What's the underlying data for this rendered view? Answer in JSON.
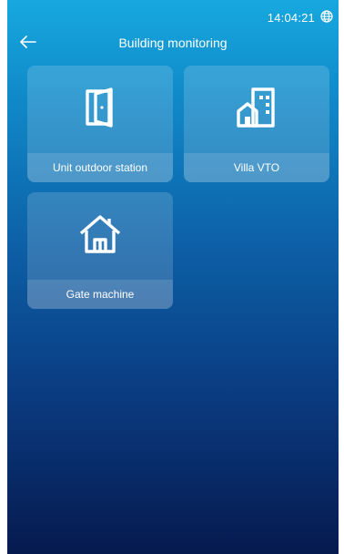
{
  "status_bar": {
    "time": "14:04:21",
    "globe_icon": "globe-icon"
  },
  "header": {
    "back_icon": "arrow-left-icon",
    "title": "Building monitoring"
  },
  "tiles": [
    {
      "label": "Unit outdoor station",
      "icon": "door-icon"
    },
    {
      "label": "Villa VTO",
      "icon": "building-icon"
    },
    {
      "label": "Gate machine",
      "icon": "house-icon"
    }
  ],
  "colors": {
    "gradient_top": "#17a8df",
    "gradient_bottom": "#061a4e",
    "text": "#ffffff"
  }
}
